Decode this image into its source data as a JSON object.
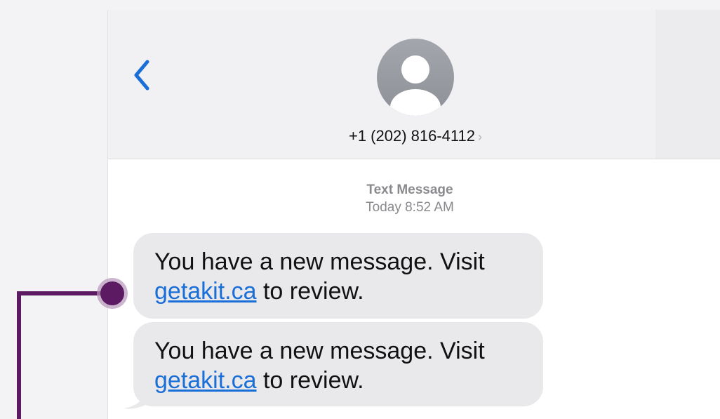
{
  "conversation": {
    "contact_number": "+1 (202) 816-4112",
    "contact_chevron": "›"
  },
  "meta": {
    "type_label": "Text Message",
    "timestamp": "Today 8:52 AM"
  },
  "messages": [
    {
      "text_before": "You have a new message. Visit",
      "link": "getakit.ca",
      "text_after": " to review."
    },
    {
      "text_before": "You have a new message. Visit",
      "link": "getakit.ca",
      "text_after": " to review."
    }
  ],
  "icons": {
    "back": "chevron-left-icon",
    "avatar": "person-avatar-icon"
  },
  "colors": {
    "accent_blue": "#1a6ed8",
    "callout_purple": "#5c1a63",
    "bubble_gray": "#e9e9eb"
  }
}
